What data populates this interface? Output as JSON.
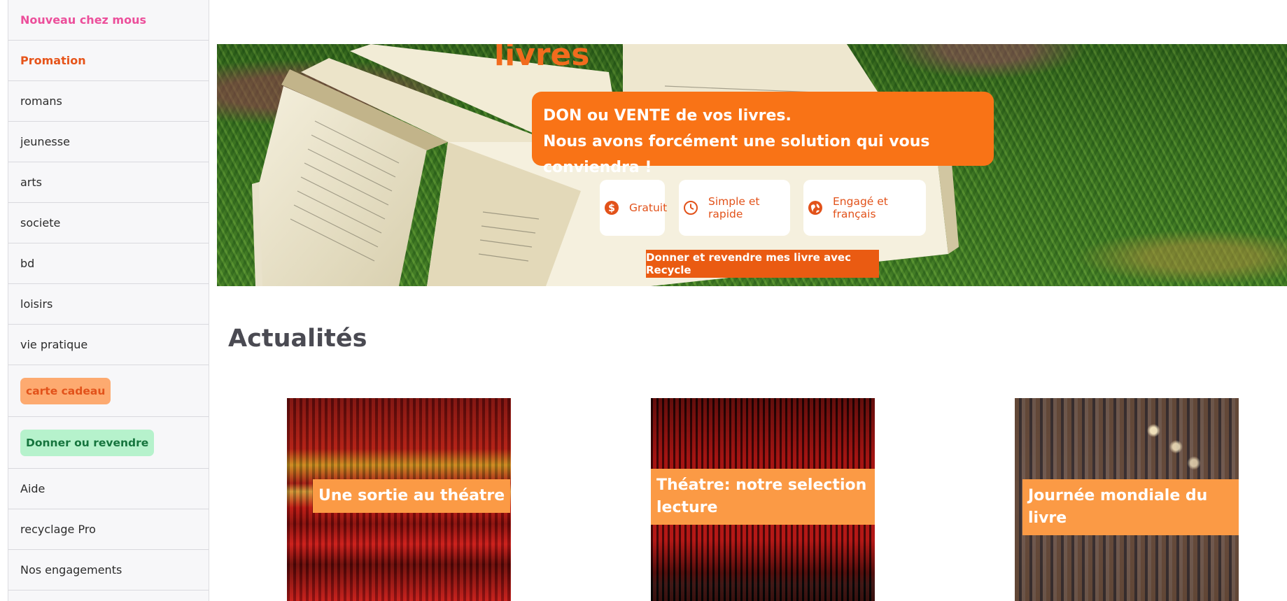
{
  "sidebar": {
    "items": [
      {
        "label": "Nouveau chez mous"
      },
      {
        "label": "Promation"
      },
      {
        "label": "romans"
      },
      {
        "label": "jeunesse"
      },
      {
        "label": "arts"
      },
      {
        "label": "societe"
      },
      {
        "label": "bd"
      },
      {
        "label": "loisirs"
      },
      {
        "label": "vie pratique"
      },
      {
        "label": "carte cadeau"
      },
      {
        "label": "Donner ou revendre"
      },
      {
        "label": "Aide"
      },
      {
        "label": "recyclage Pro"
      },
      {
        "label": "Nos engagements"
      }
    ]
  },
  "hero": {
    "title": "livres",
    "banner_line1": "DON ou VENTE de vos livres.",
    "banner_line2": "Nous avons forcément une solution qui vous conviendra !",
    "features": [
      {
        "label": "Gratuit",
        "icon": "dollar-icon"
      },
      {
        "label": "Simple et rapide",
        "icon": "clock-icon"
      },
      {
        "label": "Engagé et français",
        "icon": "globe-icon"
      }
    ],
    "cta_label": "Donner et revendre mes livre avec Recycle"
  },
  "news": {
    "title": "Actualités",
    "cards": [
      {
        "label": "Une sortie au théatre"
      },
      {
        "label": "Théatre: notre selection lecture"
      },
      {
        "label": "Journée mondiale du livre"
      }
    ]
  },
  "colors": {
    "accent": "#f97316",
    "cta": "#ea5b12",
    "card_label": "#fb9a45"
  }
}
